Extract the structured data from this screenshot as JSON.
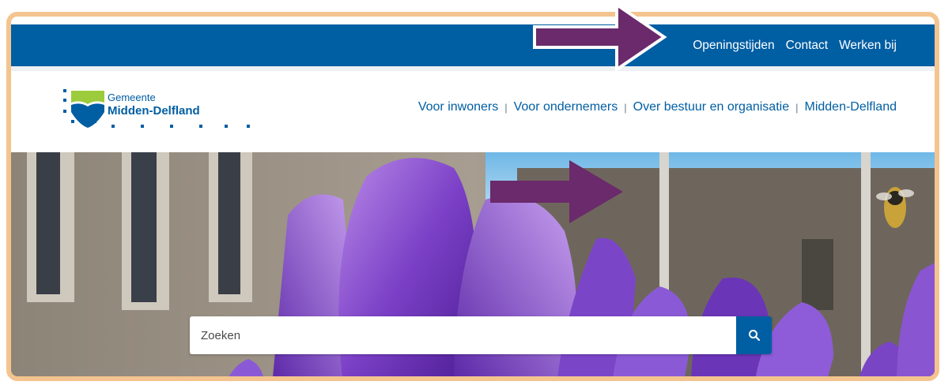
{
  "utility_nav": {
    "items": [
      "Openingstijden",
      "Contact",
      "Werken bij"
    ]
  },
  "logo": {
    "line1": "Gemeente",
    "line2": "Midden-Delfland"
  },
  "main_nav": {
    "items": [
      "Voor inwoners",
      "Voor ondernemers",
      "Over bestuur en organisatie",
      "Midden-Delfland"
    ],
    "separator": "|"
  },
  "search": {
    "placeholder": "Zoeken",
    "button_icon": "search-icon"
  },
  "annotations": {
    "arrow_color": "#6a2a6b"
  },
  "colors": {
    "brand_blue": "#005ea3",
    "frame_orange": "#f4c48f",
    "logo_green": "#9ccb3b"
  }
}
